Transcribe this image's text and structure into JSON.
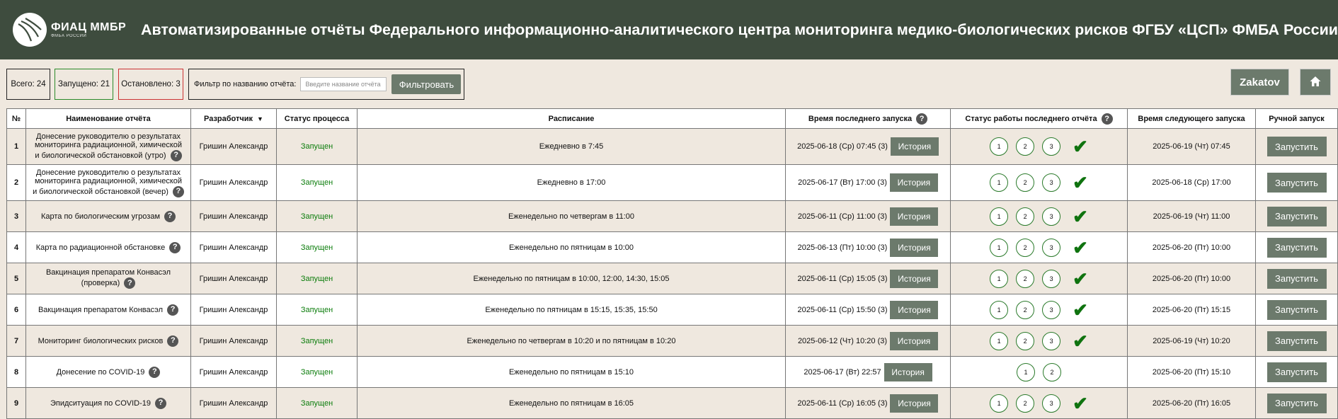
{
  "header": {
    "logo_main": "ФИАЦ ММБР",
    "logo_sub": "ФМБА РОССИИ",
    "title": "Автоматизированные отчёты Федерального информационно-аналитического центра мониторинга медико-биологических рисков ФГБУ «ЦСП» ФМБА России"
  },
  "toolbar": {
    "total": "Всего: 24",
    "running": "Запущено: 21",
    "stopped": "Остановлено: 3",
    "filter_label": "Фильтр по названию отчёта:",
    "filter_placeholder": "Введите название отчёта",
    "filter_value": "",
    "filter_button": "Фильтровать",
    "user_button": "Zakatov",
    "home_icon": "home-icon"
  },
  "colors": {
    "header_bg": "#3e4c3e",
    "button_bg": "#6c7a6c",
    "running_text": "#0c7d0c",
    "stopped_border": "#cc3333",
    "running_border": "#2a8a2a"
  },
  "table": {
    "columns": {
      "num": "№",
      "name": "Наименование отчёта",
      "developer": "Разработчик",
      "developer_sort": "▼",
      "status": "Статус процесса",
      "schedule": "Расписание",
      "last_run": "Время последнего запуска",
      "last_status": "Статус работы последнего отчёта",
      "next_run": "Время следующего запуска",
      "manual": "Ручной запуск"
    },
    "help_glyph": "?",
    "history_label": "История",
    "run_label": "Запустить",
    "rows": [
      {
        "num": "1",
        "name": "Донесение руководителю о результатах мониторинга радиационной, химической и биологической обстановкой (утро)",
        "developer": "Гришин Александр",
        "status": "Запущен",
        "schedule": "Ежедневно в 7:45",
        "last_run": "2025-06-18 (Ср) 07:45 (3)",
        "steps": [
          "1",
          "2",
          "3"
        ],
        "success": true,
        "next_run": "2025-06-19 (Чт) 07:45"
      },
      {
        "num": "2",
        "name": "Донесение руководителю о результатах мониторинга радиационной, химической и биологической обстановкой (вечер)",
        "developer": "Гришин Александр",
        "status": "Запущен",
        "schedule": "Ежедневно в 17:00",
        "last_run": "2025-06-17 (Вт) 17:00 (3)",
        "steps": [
          "1",
          "2",
          "3"
        ],
        "success": true,
        "next_run": "2025-06-18 (Ср) 17:00"
      },
      {
        "num": "3",
        "name": "Карта по биологическим угрозам",
        "developer": "Гришин Александр",
        "status": "Запущен",
        "schedule": "Еженедельно по четвергам в 11:00",
        "last_run": "2025-06-11 (Ср) 11:00 (3)",
        "steps": [
          "1",
          "2",
          "3"
        ],
        "success": true,
        "next_run": "2025-06-19 (Чт) 11:00"
      },
      {
        "num": "4",
        "name": "Карта по радиационной обстановке",
        "developer": "Гришин Александр",
        "status": "Запущен",
        "schedule": "Еженедельно по пятницам в 10:00",
        "last_run": "2025-06-13 (Пт) 10:00 (3)",
        "steps": [
          "1",
          "2",
          "3"
        ],
        "success": true,
        "next_run": "2025-06-20 (Пт) 10:00"
      },
      {
        "num": "5",
        "name": "Вакцинация препаратом Конвасэл (проверка)",
        "developer": "Гришин Александр",
        "status": "Запущен",
        "schedule": "Еженедельно по пятницам в 10:00, 12:00, 14:30, 15:05",
        "last_run": "2025-06-11 (Ср) 15:05 (3)",
        "steps": [
          "1",
          "2",
          "3"
        ],
        "success": true,
        "next_run": "2025-06-20 (Пт) 10:00"
      },
      {
        "num": "6",
        "name": "Вакцинация препаратом Конвасэл",
        "developer": "Гришин Александр",
        "status": "Запущен",
        "schedule": "Еженедельно по пятницам в 15:15, 15:35, 15:50",
        "last_run": "2025-06-11 (Ср) 15:50 (3)",
        "steps": [
          "1",
          "2",
          "3"
        ],
        "success": true,
        "next_run": "2025-06-20 (Пт) 15:15"
      },
      {
        "num": "7",
        "name": "Мониторинг биологических рисков",
        "developer": "Гришин Александр",
        "status": "Запущен",
        "schedule": "Еженедельно по четвергам в 10:20 и по пятницам в 10:20",
        "last_run": "2025-06-12 (Чт) 10:20 (3)",
        "steps": [
          "1",
          "2",
          "3"
        ],
        "success": true,
        "next_run": "2025-06-19 (Чт) 10:20"
      },
      {
        "num": "8",
        "name": "Донесение по COVID-19",
        "developer": "Гришин Александр",
        "status": "Запущен",
        "schedule": "Еженедельно по пятницам в 15:10",
        "last_run": "2025-06-17 (Вт) 22:57",
        "steps": [
          "1",
          "2"
        ],
        "success": false,
        "next_run": "2025-06-20 (Пт) 15:10"
      },
      {
        "num": "9",
        "name": "Эпидситуация по COVID-19",
        "developer": "Гришин Александр",
        "status": "Запущен",
        "schedule": "Еженедельно по пятницам в 16:05",
        "last_run": "2025-06-11 (Ср) 16:05 (3)",
        "steps": [
          "1",
          "2",
          "3"
        ],
        "success": true,
        "next_run": "2025-06-20 (Пт) 16:05"
      }
    ]
  }
}
